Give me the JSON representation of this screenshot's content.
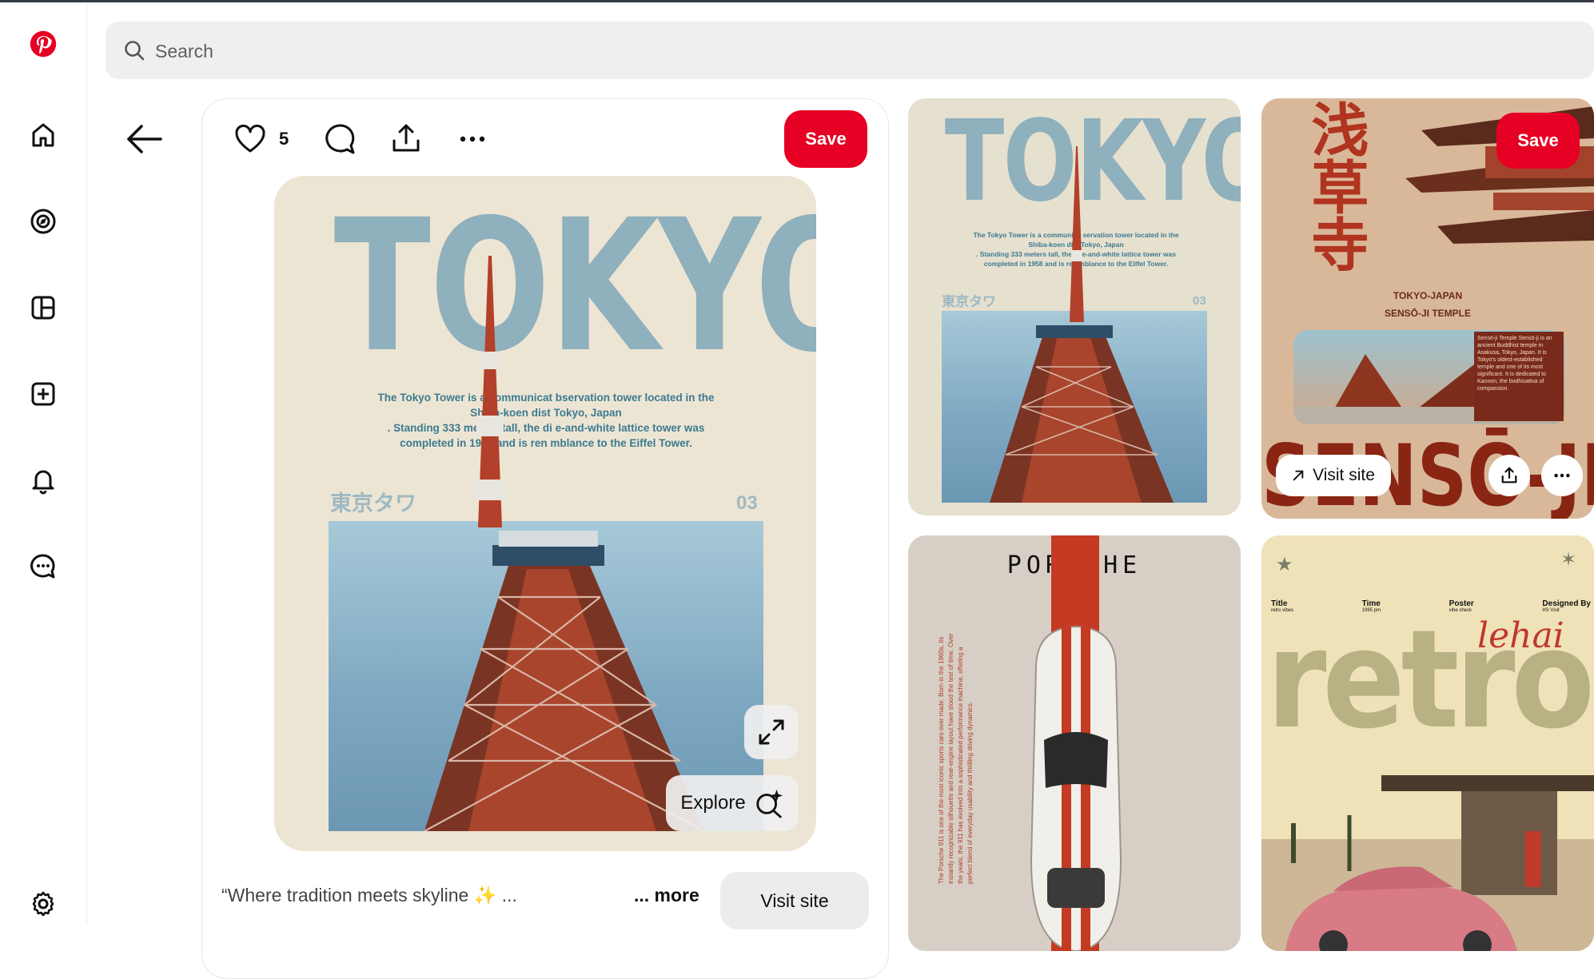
{
  "search": {
    "placeholder": "Search"
  },
  "closeup": {
    "like_count": "5",
    "save_label": "Save",
    "explore_label": "Explore",
    "description": "“Where tradition meets skyline ✨ ...",
    "more_label": "... more",
    "visit_label": "Visit site"
  },
  "poster": {
    "title": "TOKYO",
    "body_lines": [
      "The Tokyo Tower is a communicat        bservation tower located in the",
      "Shiba-koen dist           Tokyo, Japan",
      ". Standing 333 meters tall, the di       e-and-white lattice tower was",
      "completed in 1958 and is ren        mblance to the Eiffel Tower."
    ],
    "jp": "東京タワ",
    "number": "03"
  },
  "grid": {
    "tokyo_pin": {
      "title": "TOKYO",
      "body_lines": [
        "The Tokyo Tower is a communica      servation tower located in the",
        "Shiba-koen dist       Tokyo, Japan",
        ". Standing 333 meters tall, the di     e-and-white lattice tower was",
        "completed in 1958 and is ren      mblance to the Eiffel Tower."
      ],
      "jp": "東京タワ",
      "number": "03"
    },
    "senso_pin": {
      "save_label": "Save",
      "visit_label": "Visit site",
      "kanji": "浅草寺",
      "line1": "TOKYO-JAPAN",
      "line2": "SENSŌ-JI TEMPLE",
      "big": "SENSŌ-JI",
      "side_text": "Sensō-ji Temple Sensō-ji is an ancient Buddhist temple in Asakusa, Tokyo, Japan. It is Tokyo's oldest-established temple and one of its most significant. It is dedicated to Kannon, the bodhisattva of compassion."
    },
    "porsche_pin": {
      "brand": "PORSCHE",
      "side_text": "The Porsche 911 is one of the most iconic sports cars ever made. Born in the 1960s, its instantly recognizable silhouette and rear-engine layout have stood the test of time. Over the years, the 911 has evolved into a sophisticated performance machine, offering a perfect blend of everyday usability and thrilling driving dynamics."
    },
    "retro_pin": {
      "title": "retro",
      "script": "lehai",
      "meta": [
        {
          "label": "Title",
          "value": "retro vibes"
        },
        {
          "label": "Time",
          "value": "1995 pm"
        },
        {
          "label": "Poster",
          "value": "vibe check"
        },
        {
          "label": "Designed By",
          "value": "HS Visit"
        }
      ]
    }
  },
  "colors": {
    "brand_red": "#e60023",
    "search_bg": "#efefef",
    "poster_blue": "#8fb0bd"
  },
  "icons": [
    "pinterest-logo-icon",
    "home-icon",
    "explore-icon",
    "boards-icon",
    "create-icon",
    "notifications-icon",
    "messages-icon",
    "settings-icon",
    "search-icon",
    "back-arrow-icon",
    "heart-icon",
    "comment-icon",
    "share-icon",
    "more-icon",
    "expand-icon",
    "visual-search-icon",
    "external-link-icon"
  ]
}
